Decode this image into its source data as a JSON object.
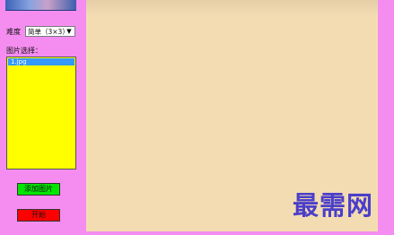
{
  "sidebar": {
    "difficulty_label": "难度",
    "difficulty_value": "简单（3×3）",
    "picture_label": "图片选择：",
    "picture_items": [
      "1.jpg"
    ],
    "add_button": "添加图片",
    "start_button": "开始"
  },
  "watermark": {
    "text": "最需网"
  },
  "colors": {
    "background": "#f58df0",
    "board": "#f4dcb2",
    "listbox": "#ffff00",
    "add_button": "#00e600",
    "start_button": "#ff0000",
    "watermark": "#4b3fc9"
  }
}
